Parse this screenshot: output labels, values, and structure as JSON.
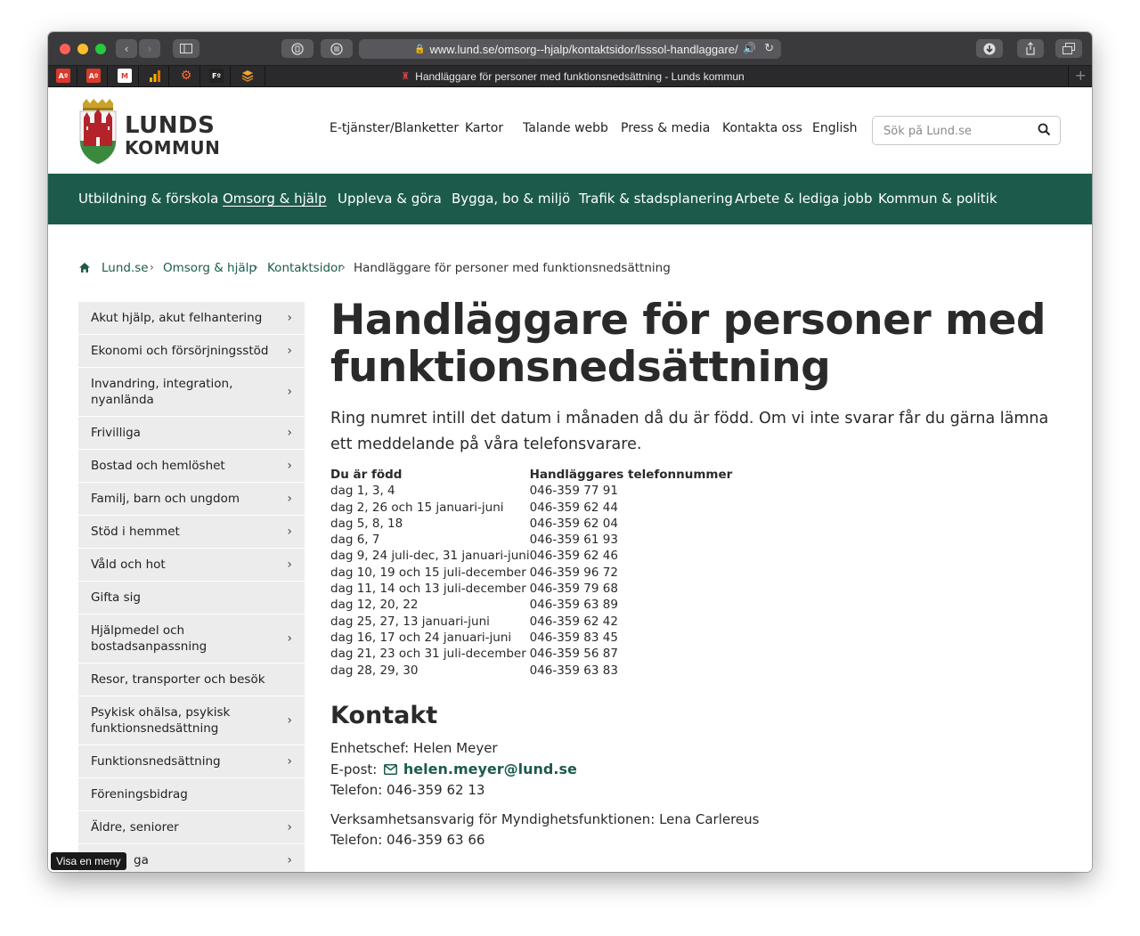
{
  "browser": {
    "url": "www.lund.se/omsorg--hjalp/kontaktsidor/lsssol-handlaggare/",
    "tab_title": "Handläggare för personer med funktionsnedsättning - Lunds kommun",
    "bookmarks": [
      "Aº",
      "Aº",
      "M",
      "chart",
      "gear",
      "Fº",
      "layers"
    ]
  },
  "header": {
    "logo_line1": "LUNDS",
    "logo_line2": "KOMMUN",
    "top_links": [
      "E-tjänster/Blanketter",
      "Kartor",
      "Talande webb",
      "Press & media",
      "Kontakta oss",
      "English"
    ],
    "search_placeholder": "Sök på Lund.se"
  },
  "main_nav": [
    "Utbildning & förskola",
    "Omsorg & hjälp",
    "Uppleva & göra",
    "Bygga, bo & miljö",
    "Trafik & stadsplanering",
    "Arbete & lediga jobb",
    "Kommun & politik"
  ],
  "main_nav_active": 1,
  "breadcrumb": [
    "Lund.se",
    "Omsorg & hjälp",
    "Kontaktsidor",
    "Handläggare för personer med funktionsnedsättning"
  ],
  "sidebar": [
    {
      "label": "Akut hjälp, akut felhantering",
      "chevron": true
    },
    {
      "label": "Ekonomi och försörjningsstöd",
      "chevron": true
    },
    {
      "label": "Invandring, integration, nyanlända",
      "chevron": true
    },
    {
      "label": "Frivilliga",
      "chevron": true
    },
    {
      "label": "Bostad och hemlöshet",
      "chevron": true
    },
    {
      "label": "Familj, barn och ungdom",
      "chevron": true
    },
    {
      "label": "Stöd i hemmet",
      "chevron": true
    },
    {
      "label": "Våld och hot",
      "chevron": true
    },
    {
      "label": "Gifta sig",
      "chevron": false
    },
    {
      "label": "Hjälpmedel och bostadsanpassning",
      "chevron": true
    },
    {
      "label": "Resor, transporter och besök",
      "chevron": false
    },
    {
      "label": "Psykisk ohälsa, psykisk funktionsnedsättning",
      "chevron": true
    },
    {
      "label": "Funktionsnedsättning",
      "chevron": true
    },
    {
      "label": "Föreningsbidrag",
      "chevron": false
    },
    {
      "label": "Äldre, seniorer",
      "chevron": true
    },
    {
      "label": "ga",
      "chevron": true
    }
  ],
  "content": {
    "title": "Handläggare för personer med funktionsnedsättning",
    "intro": "Ring numret intill det datum i månaden då du är född. Om vi inte svarar får du gärna lämna ett meddelande på våra telefonsvarare.",
    "table_headers": [
      "Du är född",
      "Handläggares telefonnummer"
    ],
    "table_rows": [
      [
        "dag 1, 3, 4",
        "046-359 77 91"
      ],
      [
        "dag 2, 26 och 15 januari-juni",
        "046-359 62 44"
      ],
      [
        "dag 5, 8, 18",
        "046-359 62 04"
      ],
      [
        "dag 6, 7",
        "046-359 61 93"
      ],
      [
        "dag 9, 24 juli-dec, 31 januari-juni",
        "046-359 62 46"
      ],
      [
        "dag 10, 19 och 15 juli-december",
        "046-359 96 72"
      ],
      [
        "dag 11, 14 och 13 juli-december",
        "046-359 79 68"
      ],
      [
        "dag 12, 20, 22",
        "046-359 63 89"
      ],
      [
        "dag 25, 27, 13 januari-juni",
        "046-359 62 42"
      ],
      [
        "dag 16, 17 och 24 januari-juni",
        "046-359 83 45"
      ],
      [
        "dag 21, 23 och 31 juli-december",
        "046-359 56 87"
      ],
      [
        "dag 28, 29, 30",
        "046-359 63 83"
      ]
    ],
    "contact_heading": "Kontakt",
    "unit_head": "Enhetschef: Helen Meyer",
    "email_label": "E-post:",
    "email": "helen.meyer@lund.se",
    "phone1": "Telefon: 046-359 62 13",
    "responsible": "Verksamhetsansvarig för Myndighetsfunktionen: Lena Carlereus",
    "phone2": "Telefon: 046-359 63 66"
  },
  "tooltip": "Visa en meny",
  "colors": {
    "brand_green": "#1c5b4c",
    "sidebar_bg": "#ececec",
    "toolbar": "#3a3a3c"
  }
}
